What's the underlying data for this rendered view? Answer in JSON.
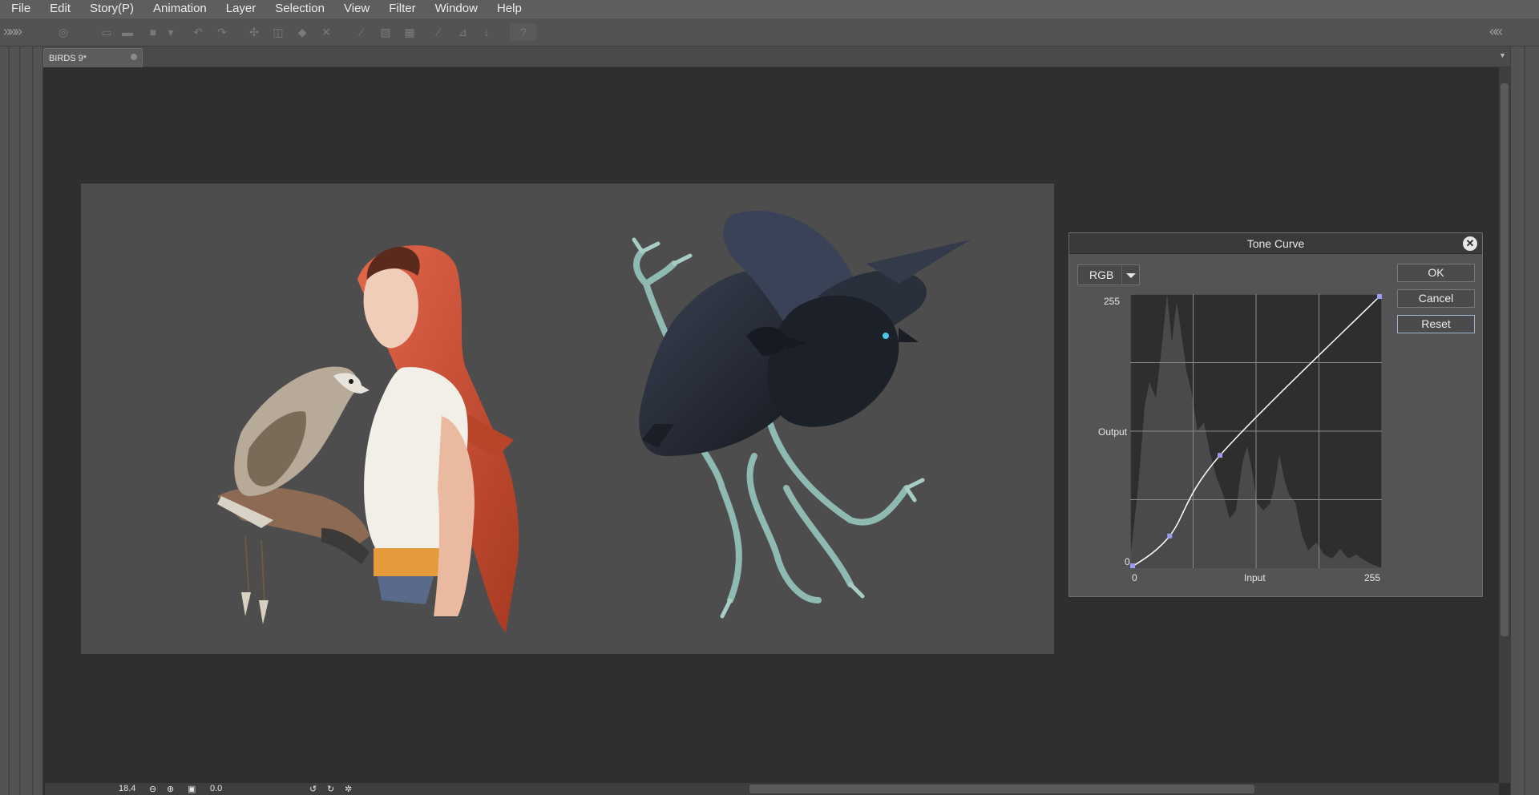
{
  "menubar": {
    "items": [
      "File",
      "Edit",
      "Story(P)",
      "Animation",
      "Layer",
      "Selection",
      "View",
      "Filter",
      "Window",
      "Help"
    ]
  },
  "document_tab": {
    "title": "BIRDS 9*"
  },
  "statusbar": {
    "zoom": "18.4",
    "rotation": "0.0"
  },
  "tone_curve_dialog": {
    "title": "Tone Curve",
    "channel": "RGB",
    "buttons": {
      "ok": "OK",
      "cancel": "Cancel",
      "reset": "Reset"
    },
    "axis": {
      "y_max": "255",
      "y_min": "0",
      "y_label": "Output",
      "x_min": "0",
      "x_max": "255",
      "x_label": "Input"
    },
    "curve_points": [
      [
        0,
        0
      ],
      [
        40,
        30
      ],
      [
        91,
        105
      ],
      [
        255,
        255
      ]
    ]
  },
  "icons": {
    "menu_collapse_left": "double-chevron-right-icon",
    "menu_collapse_right": "double-chevron-left-icon",
    "help": "help-icon",
    "close": "close-icon"
  }
}
